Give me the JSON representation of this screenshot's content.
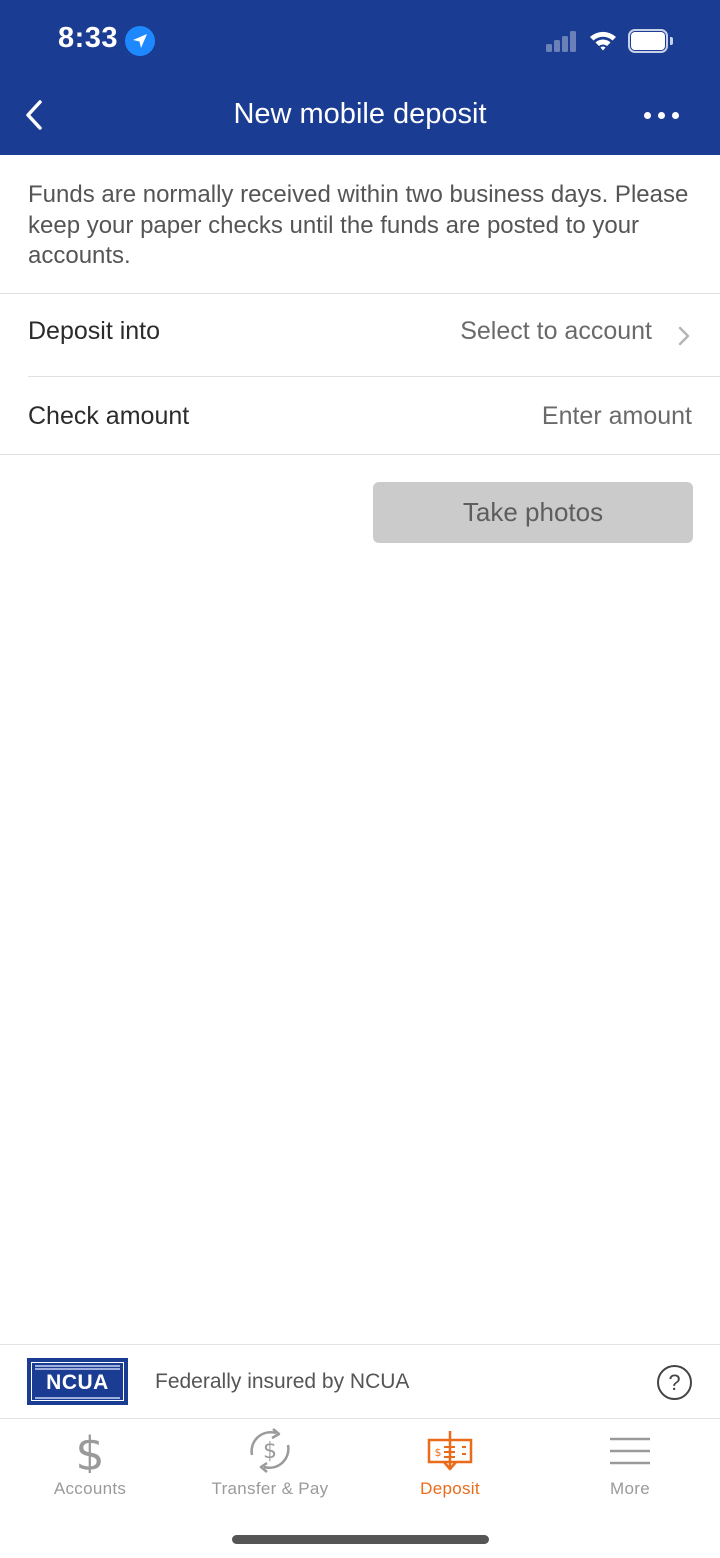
{
  "status_bar": {
    "time": "8:33"
  },
  "nav": {
    "title": "New mobile deposit"
  },
  "intro_text": "Funds are normally received within two business days. Please keep your paper checks until the funds are posted to your accounts.",
  "form": {
    "deposit_into": {
      "label": "Deposit into",
      "value": "Select to account"
    },
    "check_amount": {
      "label": "Check amount",
      "placeholder": "Enter amount"
    }
  },
  "take_photos_label": "Take photos",
  "ncua": {
    "logo_text": "NCUA",
    "text": "Federally insured by NCUA",
    "help_symbol": "?"
  },
  "tabs": [
    {
      "label": "Accounts",
      "icon": "dollar-icon",
      "active": false
    },
    {
      "label": "Transfer & Pay",
      "icon": "transfer-pay-icon",
      "active": false
    },
    {
      "label": "Deposit",
      "icon": "check-deposit-icon",
      "active": true
    },
    {
      "label": "More",
      "icon": "menu-icon",
      "active": false
    }
  ],
  "colors": {
    "header": "#1b3c93",
    "active_tab": "#ea6c1a",
    "button_disabled": "#cbcbcb"
  }
}
